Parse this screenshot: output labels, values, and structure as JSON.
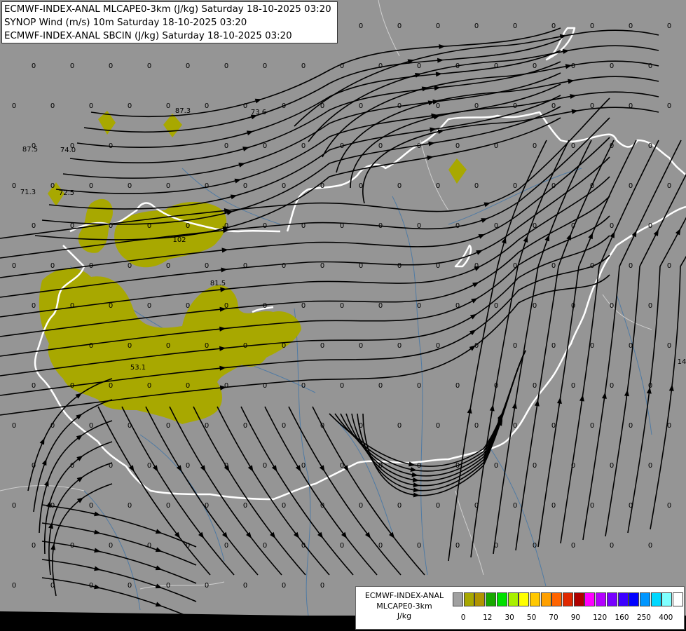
{
  "title_lines": [
    "ECMWF-INDEX-ANAL MLCAPE0-3km (J/kg) Saturday 18-10-2025 03:20",
    "SYNOP Wind (m/s) 10m Saturday 18-10-2025 03:20",
    "ECMWF-INDEX-ANAL SBCIN (J/kg) Saturday 18-10-2025 03:20"
  ],
  "legend": {
    "title": [
      "ECMWF-INDEX-ANAL",
      "MLCAPE0-3km",
      "J/kg"
    ],
    "colors": [
      "#a0a0a0",
      "#a8a800",
      "#b09400",
      "#18a800",
      "#00e000",
      "#a8f000",
      "#ffff00",
      "#ffc800",
      "#ffa000",
      "#ff6400",
      "#e02800",
      "#b00000",
      "#ff00ff",
      "#b400ff",
      "#7800ff",
      "#3c00ff",
      "#0000ff",
      "#0096ff",
      "#00d8ff",
      "#80ffff",
      "#ffffff"
    ],
    "tick_labels": [
      "0",
      "12",
      "30",
      "50",
      "70",
      "90",
      "120",
      "160",
      "250",
      "400"
    ]
  },
  "map": {
    "background": "#959595",
    "cape_color": "#a8a800",
    "cape_labels": [
      "87.3",
      "73.6",
      "87.5",
      "74.0",
      "71.3",
      "72.5",
      "102",
      "81.5",
      "53.1",
      "14"
    ],
    "cin_value": "0"
  }
}
